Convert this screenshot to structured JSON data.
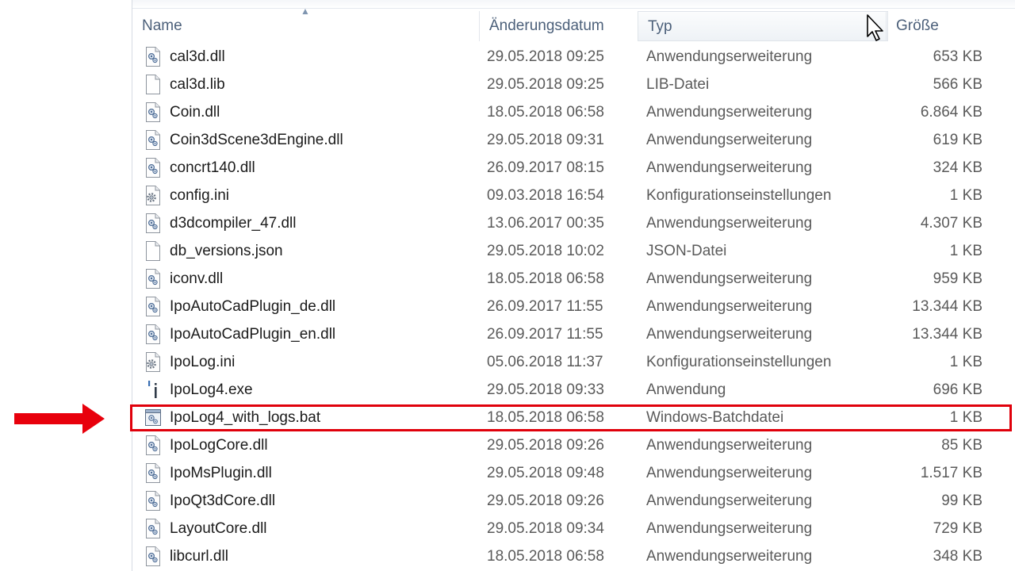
{
  "columns": {
    "name": "Name",
    "date": "Änderungsdatum",
    "type": "Typ",
    "size": "Größe"
  },
  "files": [
    {
      "name": "cal3d.dll",
      "date": "29.05.2018 09:25",
      "type": "Anwendungserweiterung",
      "size": "653 KB",
      "icon": "dll-file-icon"
    },
    {
      "name": "cal3d.lib",
      "date": "29.05.2018 09:25",
      "type": "LIB-Datei",
      "size": "566 KB",
      "icon": "blank-file-icon"
    },
    {
      "name": "Coin.dll",
      "date": "18.05.2018 06:58",
      "type": "Anwendungserweiterung",
      "size": "6.864 KB",
      "icon": "dll-file-icon"
    },
    {
      "name": "Coin3dScene3dEngine.dll",
      "date": "29.05.2018 09:31",
      "type": "Anwendungserweiterung",
      "size": "619 KB",
      "icon": "dll-file-icon"
    },
    {
      "name": "concrt140.dll",
      "date": "26.09.2017 08:15",
      "type": "Anwendungserweiterung",
      "size": "324 KB",
      "icon": "dll-file-icon"
    },
    {
      "name": "config.ini",
      "date": "09.03.2018 16:54",
      "type": "Konfigurationseinstellungen",
      "size": "1 KB",
      "icon": "ini-file-icon"
    },
    {
      "name": "d3dcompiler_47.dll",
      "date": "13.06.2017 00:35",
      "type": "Anwendungserweiterung",
      "size": "4.307 KB",
      "icon": "dll-file-icon"
    },
    {
      "name": "db_versions.json",
      "date": "29.05.2018 10:02",
      "type": "JSON-Datei",
      "size": "1 KB",
      "icon": "blank-file-icon"
    },
    {
      "name": "iconv.dll",
      "date": "18.05.2018 06:58",
      "type": "Anwendungserweiterung",
      "size": "959 KB",
      "icon": "dll-file-icon"
    },
    {
      "name": "IpoAutoCadPlugin_de.dll",
      "date": "26.09.2017 11:55",
      "type": "Anwendungserweiterung",
      "size": "13.344 KB",
      "icon": "dll-file-icon"
    },
    {
      "name": "IpoAutoCadPlugin_en.dll",
      "date": "26.09.2017 11:55",
      "type": "Anwendungserweiterung",
      "size": "13.344 KB",
      "icon": "dll-file-icon"
    },
    {
      "name": "IpoLog.ini",
      "date": "05.06.2018 11:37",
      "type": "Konfigurationseinstellungen",
      "size": "1 KB",
      "icon": "ini-file-icon"
    },
    {
      "name": "IpoLog4.exe",
      "date": "29.05.2018 09:33",
      "type": "Anwendung",
      "size": "696 KB",
      "icon": "exe-file-icon"
    },
    {
      "name": "IpoLog4_with_logs.bat",
      "date": "18.05.2018 06:58",
      "type": "Windows-Batchdatei",
      "size": "1 KB",
      "icon": "bat-file-icon"
    },
    {
      "name": "IpoLogCore.dll",
      "date": "29.05.2018 09:26",
      "type": "Anwendungserweiterung",
      "size": "85 KB",
      "icon": "dll-file-icon"
    },
    {
      "name": "IpoMsPlugin.dll",
      "date": "29.05.2018 09:48",
      "type": "Anwendungserweiterung",
      "size": "1.517 KB",
      "icon": "dll-file-icon"
    },
    {
      "name": "IpoQt3dCore.dll",
      "date": "29.05.2018 09:26",
      "type": "Anwendungserweiterung",
      "size": "99 KB",
      "icon": "dll-file-icon"
    },
    {
      "name": "LayoutCore.dll",
      "date": "29.05.2018 09:34",
      "type": "Anwendungserweiterung",
      "size": "729 KB",
      "icon": "dll-file-icon"
    },
    {
      "name": "libcurl.dll",
      "date": "18.05.2018 06:58",
      "type": "Anwendungserweiterung",
      "size": "348 KB",
      "icon": "dll-file-icon"
    }
  ],
  "colors": {
    "highlight": "#e0000b",
    "arrow": "#e8000c"
  }
}
